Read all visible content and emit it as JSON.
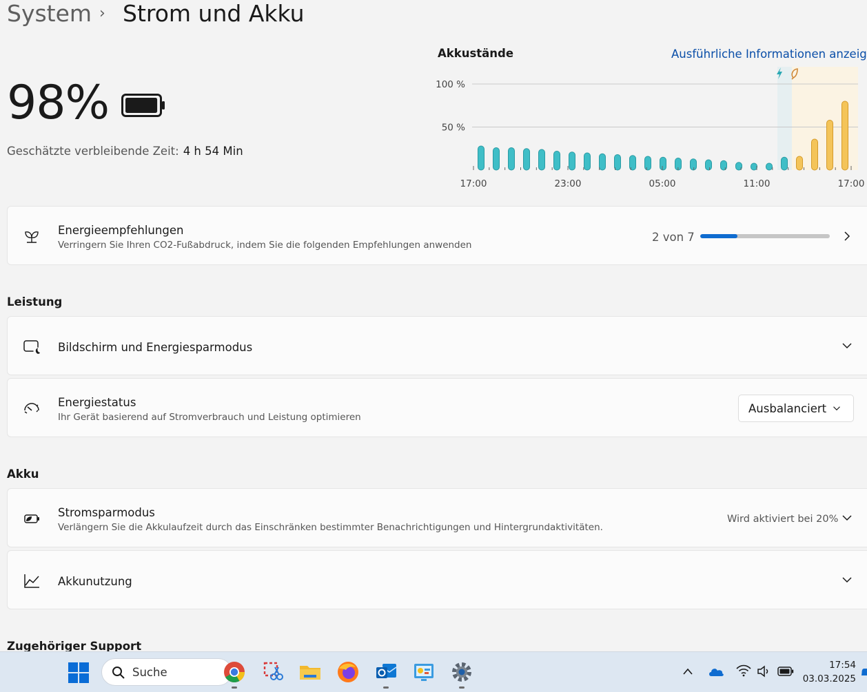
{
  "breadcrumb": {
    "parent": "System",
    "separator": "›",
    "current": "Strom und Akku"
  },
  "battery": {
    "percent_text": "98%",
    "level": 0.98,
    "remaining_label": "Geschätzte verbleibende Zeit:",
    "remaining_value": "4 h 54 Min"
  },
  "chart": {
    "title": "Akkustände",
    "details_link": "Ausführliche Informationen anzeigen"
  },
  "chart_data": {
    "type": "bar",
    "title": "Akkustände",
    "y_tick_labels": [
      "100 %",
      "50 %"
    ],
    "y_ticks": [
      100,
      50
    ],
    "ylim": [
      0,
      100
    ],
    "x_tick_labels": [
      "17:00",
      "23:00",
      "05:00",
      "11:00",
      "17:00"
    ],
    "grid": true,
    "series": [
      {
        "values": [
          28,
          26,
          26,
          25,
          24,
          22,
          21,
          20,
          19,
          18,
          17,
          16,
          15,
          14,
          13,
          12,
          11,
          9,
          8,
          8,
          15
        ]
      },
      {
        "values": [
          16,
          36,
          58,
          80
        ]
      }
    ],
    "colors": {
      "usage": "#3fbec7",
      "charging": "#f4c459",
      "charging_band": "#fbf3e3",
      "plug_band": "#e6eff1"
    }
  },
  "energy_recommendations": {
    "title": "Energieempfehlungen",
    "subtitle": "Verringern Sie Ihren CO2-Fußabdruck, indem Sie die folgenden Empfehlungen anwenden",
    "progress_text": "2 von 7",
    "progress_done": 2,
    "progress_total": 7,
    "icon": "leaf-icon"
  },
  "sections": {
    "performance": "Leistung",
    "battery": "Akku",
    "support": "Zugehöriger Support"
  },
  "screen_sleep": {
    "title": "Bildschirm und Energiesparmodus",
    "icon": "screen-sleep-icon"
  },
  "power_mode": {
    "title": "Energiestatus",
    "subtitle": "Ihr Gerät basierend auf Stromverbrauch und Leistung optimieren",
    "value": "Ausbalanciert",
    "icon": "gauge-icon"
  },
  "battery_saver": {
    "title": "Stromsparmodus",
    "subtitle": "Verlängern Sie die Akkulaufzeit durch das Einschränken bestimmter Benachrichtigungen und Hintergrundaktivitäten.",
    "status": "Wird aktiviert bei 20%",
    "icon": "battery-saver-icon"
  },
  "battery_usage": {
    "title": "Akkunutzung",
    "icon": "line-chart-icon"
  },
  "taskbar": {
    "search_label": "Suche",
    "time": "17:54",
    "date": "03.03.2025",
    "apps": [
      "windows-start-icon",
      "chrome-icon",
      "snipping-tool-icon",
      "file-explorer-icon",
      "firefox-icon",
      "outlook-icon",
      "control-panel-icon",
      "settings-icon"
    ]
  },
  "colors": {
    "accent": "#0f6cd0",
    "link": "#0a4ea8"
  }
}
